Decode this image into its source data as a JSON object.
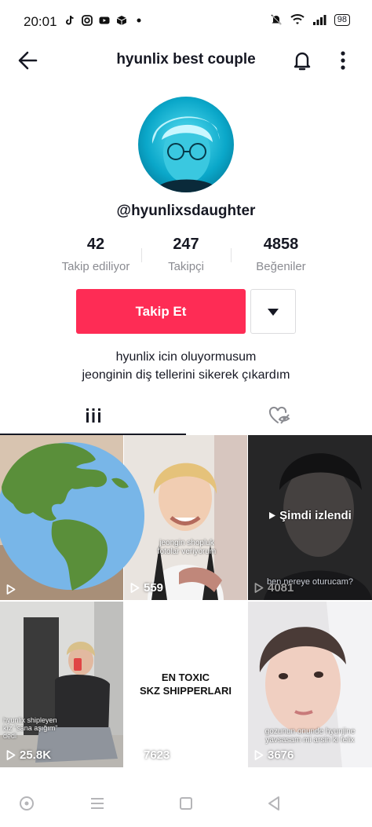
{
  "status": {
    "time": "20:01",
    "battery": "98"
  },
  "header": {
    "title": "hyunlix best couple"
  },
  "profile": {
    "username": "@hyunlixsdaughter",
    "stats": [
      {
        "num": "42",
        "label": "Takip ediliyor"
      },
      {
        "num": "247",
        "label": "Takipçi"
      },
      {
        "num": "4858",
        "label": "Beğeniler"
      }
    ],
    "follow_label": "Takip Et",
    "bio_line1": "hyunlix icin oluyormusum",
    "bio_line2": "jeonginin diş tellerini sikerek çıkardım"
  },
  "videos": [
    {
      "views": "",
      "overlay": ""
    },
    {
      "views": "559",
      "overlay": "jeongin shopluk fotolar veriyorum"
    },
    {
      "views": "4081",
      "overlay": "ben nereye oturucam?",
      "badge": "Şimdi izlendi"
    },
    {
      "views": "25.8K",
      "overlay": "hyunlix shipleyen kız \"sana aşığım\" dedi"
    },
    {
      "views": "7623",
      "title_line1": "EN TOXIC",
      "title_line2": "SKZ SHIPPERLARI"
    },
    {
      "views": "3676",
      "overlay": "gozunun onunde hyunjine yavsasam mi arsin ki felix"
    }
  ],
  "icons": {
    "back": "arrow-left-icon",
    "bell": "bell-icon",
    "more": "more-vertical-icon",
    "grid": "grid-icon",
    "liked": "liked-heart-icon",
    "globe": "globe-icon"
  },
  "colors": {
    "accent": "#fe2c55",
    "text": "#161823",
    "muted": "#8a8b91"
  }
}
